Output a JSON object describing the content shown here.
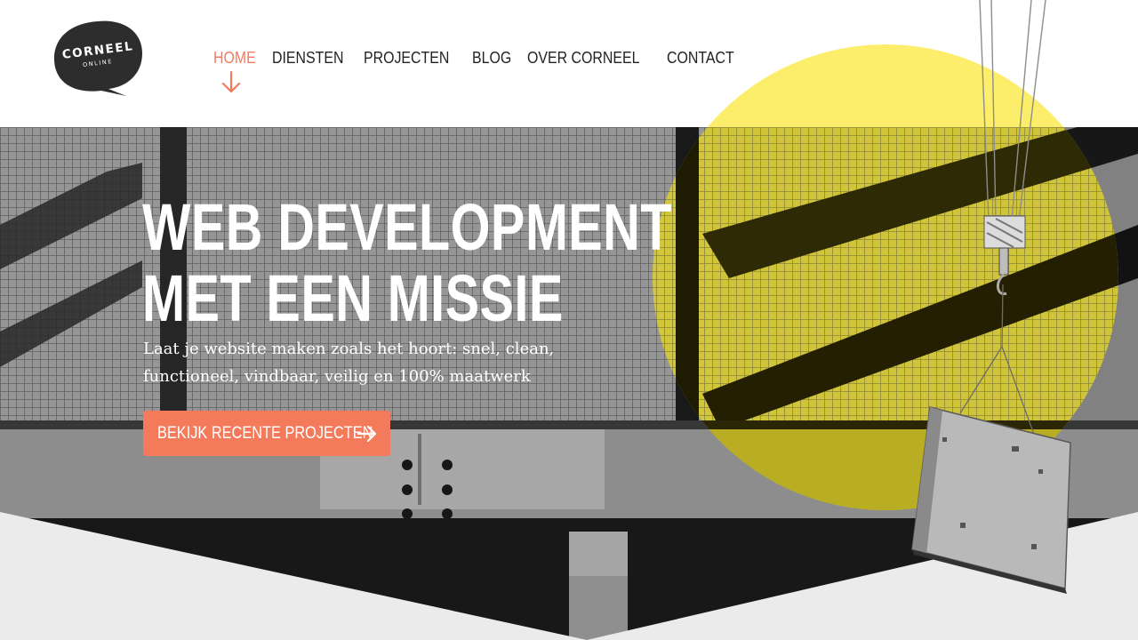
{
  "brand": {
    "name": "CORNEEL",
    "tagline": "ONLINE"
  },
  "nav": {
    "items": [
      {
        "label": "HOME",
        "active": true
      },
      {
        "label": "DIENSTEN",
        "active": false
      },
      {
        "label": "PROJECTEN",
        "active": false
      },
      {
        "label": "BLOG",
        "active": false
      },
      {
        "label": "OVER CORNEEL",
        "active": false
      },
      {
        "label": "CONTACT",
        "active": false
      }
    ],
    "active_icon": "arrow-down-icon"
  },
  "hero": {
    "title_line1": "WEB DEVELOPMENT",
    "title_line2": "MET EEN MISSIE",
    "subtitle": "Laat je website maken zoals het hoort: snel, clean, functioneel, vindbaar, veilig en 100% maatwerk",
    "cta_label": "BEKIJK RECENTE PROJECTEN",
    "cta_icon": "arrow-right-icon"
  },
  "colors": {
    "accent": "#f47a5c",
    "yellow": "#fcee6b",
    "dark": "#2d2d2d"
  }
}
